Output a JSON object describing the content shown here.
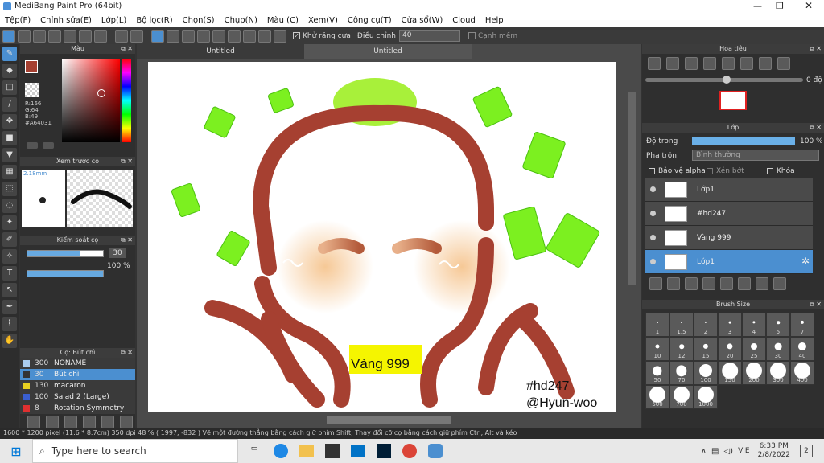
{
  "window": {
    "title": "MediBang Paint Pro (64bit)"
  },
  "menu": [
    "Tệp(F)",
    "Chỉnh sửa(E)",
    "Lớp(L)",
    "Bộ lọc(R)",
    "Chọn(S)",
    "Chụp(N)",
    "Màu (C)",
    "Xem(V)",
    "Công cụ(T)",
    "Cửa sổ(W)",
    "Cloud",
    "Help"
  ],
  "toolbar": {
    "antialias_label": "Khử răng cưa",
    "correction_label": "Điều chỉnh",
    "correction_value": "40",
    "smooth_label": "Cạnh mềm"
  },
  "color_panel": {
    "title": "Màu",
    "r": "R:166",
    "g": "G:64",
    "b": "B:49",
    "hex": "#A64031",
    "main_color": "#A64031"
  },
  "brush_preview": {
    "title": "Xem trước cọ",
    "size": "2.18mm"
  },
  "brush_control": {
    "title": "Kiểm soát cọ",
    "size_value": "30",
    "opacity_value": "100 %",
    "size_fraction": 0.7,
    "opacity_fraction": 1.0
  },
  "brush_list": {
    "title": "Cọ: Bút chì",
    "items": [
      {
        "size": "300",
        "name": "NONAME",
        "color": "#aaccee"
      },
      {
        "size": "30",
        "name": "Bút chì",
        "color": "#333333",
        "selected": true
      },
      {
        "size": "130",
        "name": "macaron",
        "color": "#e8d020"
      },
      {
        "size": "100",
        "name": "Salad 2 (Large)",
        "color": "#3a5fd0"
      },
      {
        "size": "8",
        "name": "Rotation Symmetry",
        "color": "#e03030"
      }
    ]
  },
  "tabs": [
    {
      "label": "Untitled"
    },
    {
      "label": "Untitled"
    }
  ],
  "canvas": {
    "sign_text": "Vàng 999",
    "credit1": "#hd247",
    "credit2": "@Hyun-woo"
  },
  "navigator": {
    "title": "Hoa tiêu",
    "angle": "0 độ"
  },
  "layer_panel": {
    "title": "Lớp",
    "opacity_label": "Độ trong",
    "opacity_value": "100 %",
    "opacity_fraction": 1.0,
    "blend_label": "Pha trộn",
    "blend_value": "Bình thường",
    "protect_alpha": "Bảo vệ alpha",
    "clip": "Xén bớt",
    "lock": "Khóa",
    "layers": [
      {
        "name": "Lớp1",
        "selected": false
      },
      {
        "name": "#hd247",
        "selected": false
      },
      {
        "name": "Vàng 999",
        "selected": false
      },
      {
        "name": "Lớp1",
        "selected": true
      }
    ]
  },
  "brush_size": {
    "title": "Brush Size",
    "sizes": [
      "1",
      "1.5",
      "2",
      "3",
      "4",
      "5",
      "7",
      "10",
      "12",
      "15",
      "20",
      "25",
      "30",
      "40",
      "50",
      "70",
      "100",
      "150",
      "200",
      "300",
      "400",
      "500",
      "700",
      "1000"
    ]
  },
  "status": {
    "text": "1600 * 1200 pixel   (11.6 * 8.7cm)   350 dpi   48 %   ( 1997, -832 )   Vẽ một đường thẳng bằng cách giữ phím Shift, Thay đổi cỡ cọ bằng cách giữ phím Ctrl, Alt và kéo"
  },
  "taskbar": {
    "search_placeholder": "Type here to search",
    "time": "6:33 PM",
    "date": "2/8/2022",
    "lang": "VIE",
    "notif": "2"
  }
}
